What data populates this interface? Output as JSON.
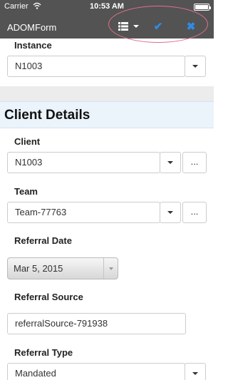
{
  "status_bar": {
    "carrier": "Carrier",
    "time": "10:53 AM"
  },
  "nav": {
    "title": "ADOMForm",
    "check_glyph": "✔",
    "close_glyph": "✖"
  },
  "icons": {
    "list": "list-view-icon",
    "caret": "caret-down-icon",
    "save": "check-icon",
    "close": "close-icon",
    "wifi": "wifi-icon",
    "battery": "battery-icon"
  },
  "colors": {
    "accent": "#2f8be6",
    "bar": "#535353",
    "section_bg": "#ebf3fb",
    "annotation": "#e0708a"
  },
  "form": {
    "instance": {
      "label": "Instance",
      "value": "N1003"
    },
    "section_title": "Client Details",
    "client": {
      "label": "Client",
      "value": "N1003",
      "more": "..."
    },
    "team": {
      "label": "Team",
      "value": "Team-77763",
      "more": "..."
    },
    "referral_date": {
      "label": "Referral Date",
      "value": "Mar 5, 2015"
    },
    "referral_source": {
      "label": "Referral Source",
      "value": "referralSource-791938"
    },
    "referral_type": {
      "label": "Referral Type",
      "value": "Mandated"
    }
  }
}
